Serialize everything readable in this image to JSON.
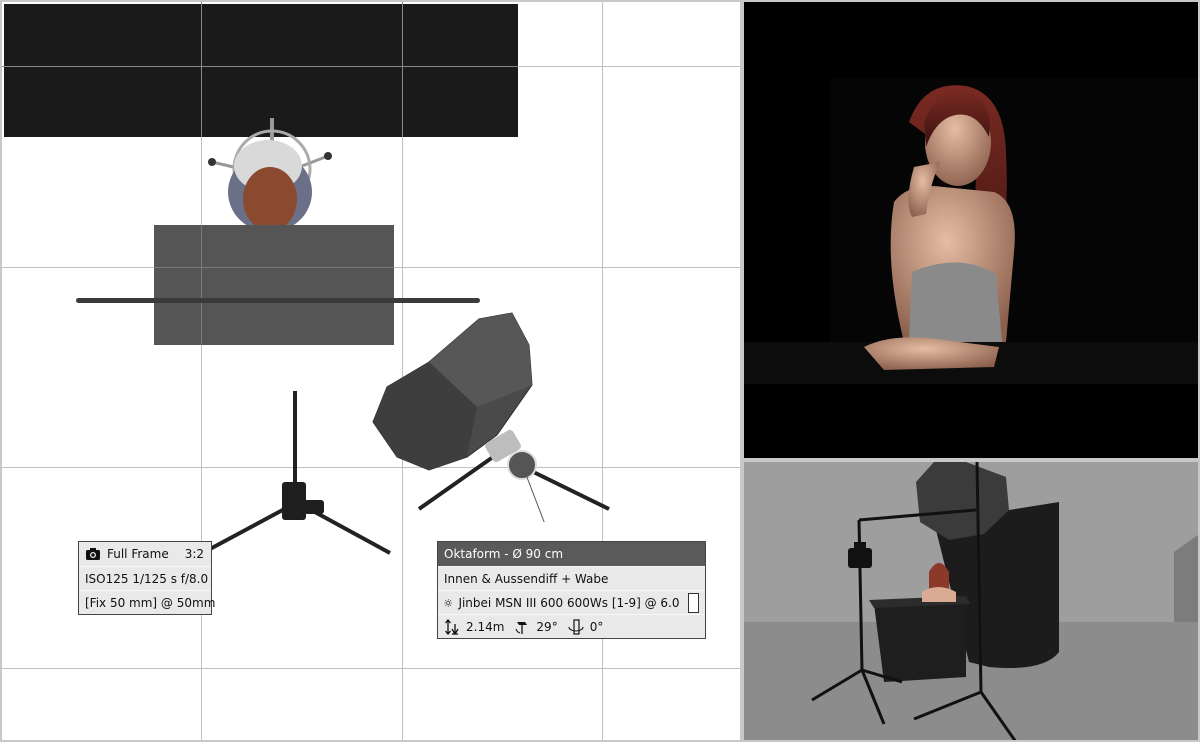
{
  "camera": {
    "format": "Full Frame",
    "ratio": "3:2",
    "exposure": "ISO125  1/125 s  f/8.0",
    "lens": "[Fix 50 mm] @ 50mm"
  },
  "light": {
    "modifier": "Oktaform - Ø 90 cm",
    "diffusion": "Innen & Aussendiff + Wabe",
    "head": "Jinbei MSN III 600  600Ws [1-9] @ 6.0",
    "height": "2.14m",
    "tilt": "29°",
    "rotation": "0°",
    "color": "#ffffff"
  },
  "icons": {
    "camera": "camera-icon",
    "light": "sun-icon",
    "height": "height-icon",
    "tilt": "tilt-icon",
    "rotation": "rotation-icon"
  }
}
